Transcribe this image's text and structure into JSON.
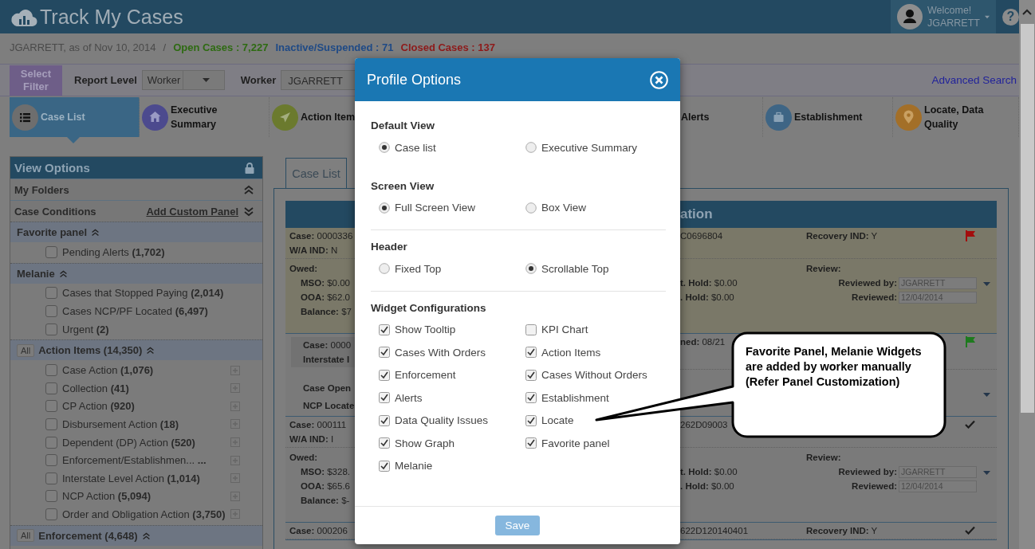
{
  "header": {
    "title": "Track My Cases",
    "welcome": "Welcome!",
    "user": "JGARRETT",
    "help": "?"
  },
  "info_bar": {
    "as_of": "JGARRETT, as of Nov 10, 2014",
    "separator": "/",
    "stats": [
      {
        "text": "Open Cases : 7,227",
        "color": "#2e6b12"
      },
      {
        "text": "Inactive/Suspended : 71",
        "color": "#1f4a86"
      },
      {
        "text": "Closed Cases : 137",
        "color": "#8e1a1a"
      }
    ]
  },
  "filter_bar": {
    "select_filter": "Select Filter",
    "report_level_label": "Report Level",
    "report_level": "Worker",
    "worker_label": "Worker",
    "worker": "JGARRETT",
    "advanced_search": "Advanced Search"
  },
  "nav": [
    {
      "label": "Case List",
      "selected": true,
      "color": "#6e6e6e"
    },
    {
      "label": "Executive Summary",
      "selected": false,
      "color": "#4c4a8e"
    },
    {
      "label": "Action Item",
      "selected": false,
      "color": "#6b7a2e"
    },
    {
      "label": "Alerts",
      "selected": false
    },
    {
      "label": "Establishment",
      "selected": false,
      "color": "#3e6585"
    },
    {
      "label": "Locate, Data Quality",
      "selected": false,
      "color": "#a36f28"
    }
  ],
  "sidebar": {
    "title": "View Options",
    "folders": [
      {
        "label": "My Folders",
        "expanded": true
      },
      {
        "label": "Case Conditions",
        "link": "Add Custom Panel",
        "expanded": false
      }
    ],
    "groups": [
      {
        "title": "Favorite panel",
        "expanded": true,
        "items": [
          {
            "text": "Pending Alerts **(1,702)**",
            "checked": false
          }
        ]
      },
      {
        "title": "Melanie",
        "expanded": true,
        "items": [
          {
            "text": "Cases that Stopped Paying **(2,014)**",
            "checked": false
          },
          {
            "text": "Cases NCP/PF Located **(6,497)**",
            "checked": false
          },
          {
            "text": "Urgent **(2)**",
            "checked": false
          }
        ]
      },
      {
        "all": "All",
        "title": "Action Items (14,350)",
        "expanded": true,
        "items": [
          {
            "text": "Case Action **(1,076)**",
            "checked": false,
            "expandable": true
          },
          {
            "text": "Collection **(41)**",
            "checked": false,
            "expandable": true
          },
          {
            "text": "CP Action **(920)**",
            "checked": false,
            "expandable": true
          },
          {
            "text": "Disbursement Action **(18)**",
            "checked": false,
            "expandable": true
          },
          {
            "text": "Dependent (DP) Action **(520)**",
            "checked": false,
            "expandable": true
          },
          {
            "text": "Enforcement/Establishmen... **...**",
            "checked": false,
            "expandable": true
          },
          {
            "text": "Interstate Level Action **(1,014)**",
            "checked": false,
            "expandable": true
          },
          {
            "text": "NCP Action **(5,094)**",
            "checked": false,
            "expandable": true
          },
          {
            "text": "Order and Obligation Action **(3,750)**",
            "checked": false,
            "expandable": true
          }
        ]
      },
      {
        "all": "All",
        "title": "Enforcement (4,648)",
        "expanded": true
      }
    ]
  },
  "case_list": {
    "tab": "Case List",
    "heading": "ation",
    "rows": [
      {
        "highlighted": true,
        "top_left": [
          "**Case:** 0000336",
          "**W/A IND:** N"
        ],
        "top_right": [
          "C0696804",
          "**Recovery IND:** Y"
        ],
        "marker": {
          "kind": "flag",
          "color": "#a30d0d"
        },
        "bottom_left": {
          "title": "Owed:",
          "lines": [
            "**MSO:** $0.00",
            "**OOA:** $62.0",
            "**Balance:** $7"
          ]
        },
        "holds": [
          "**t. Hold:** $0.00",
          "**. Hold:** $0.00"
        ],
        "review": {
          "title": "Review:",
          "fields": [
            {
              "label": "Reviewed by:",
              "value": "JGARRETT"
            },
            {
              "label": "Reviewed:",
              "value": "12/04/2014"
            }
          ]
        },
        "has_menu": true
      },
      {
        "highlighted": false,
        "inset": true,
        "top_left": [
          "**Case:** 0000",
          "**Interstate I**"
        ],
        "top_right": [
          "**ned:** 08/21"
        ],
        "marker": {
          "kind": "flag",
          "color": "#1e7a1e"
        },
        "bottom_left": {
          "lines": [
            "**Case Open**",
            "**NCP Locate**"
          ]
        },
        "has_menu": true
      },
      {
        "highlighted": false,
        "top_left": [
          "**Case:** 000111",
          "**W/A IND:** I"
        ],
        "top_right": [
          "262D09003"
        ],
        "marker": {
          "kind": "check"
        },
        "bottom_left": {
          "title": "Owed:",
          "lines": [
            "**MSO:** $328.",
            "**OOA:** $65.6",
            "**Balance:** $-"
          ]
        },
        "holds": [
          "**t. Hold:** $0.00",
          "**. Hold:** $0.00"
        ],
        "review": {
          "title": "Review:",
          "fields": [
            {
              "label": "Reviewed by:",
              "value": "JGARRETT"
            },
            {
              "label": "Reviewed:",
              "value": "12/04/2014"
            }
          ]
        },
        "has_menu": true
      },
      {
        "highlighted": false,
        "top_left": [
          "**Case:** 000206"
        ],
        "top_right": [
          "622D120140401",
          "**Recovery IND:** Y"
        ],
        "marker": {
          "kind": "check"
        }
      }
    ]
  },
  "modal": {
    "title": "Profile Options",
    "sections": [
      {
        "title": "Default View",
        "kind": "radio",
        "options": [
          {
            "label": "Case list",
            "selected": true
          },
          {
            "label": "Executive Summary",
            "selected": false
          }
        ]
      },
      {
        "title": "Screen View",
        "kind": "radio",
        "options": [
          {
            "label": "Full Screen View",
            "selected": true
          },
          {
            "label": "Box View",
            "selected": false
          }
        ]
      },
      {
        "title": "Header",
        "kind": "radio",
        "separated": true,
        "options": [
          {
            "label": "Fixed Top",
            "selected": false
          },
          {
            "label": "Scrollable Top",
            "selected": true
          }
        ]
      },
      {
        "title": "Widget Configurations",
        "kind": "checkbox",
        "separated": true,
        "options": [
          {
            "label": "Show Tooltip",
            "checked": true
          },
          {
            "label": "KPI Chart",
            "checked": false
          },
          {
            "label": "Cases With Orders",
            "checked": true
          },
          {
            "label": "Action Items",
            "checked": true
          },
          {
            "label": "Enforcement",
            "checked": true
          },
          {
            "label": "Cases Without Orders",
            "checked": true
          },
          {
            "label": "Alerts",
            "checked": true
          },
          {
            "label": "Establishment",
            "checked": true
          },
          {
            "label": "Data Quality Issues",
            "checked": true
          },
          {
            "label": "Locate",
            "checked": true
          },
          {
            "label": "Show Graph",
            "checked": true
          },
          {
            "label": "Favorite panel",
            "checked": true
          },
          {
            "label": "Melanie",
            "checked": true
          }
        ]
      }
    ],
    "save": "Save"
  },
  "callout": {
    "text": "Favorite Panel, Melanie Widgets are added by worker manually (Refer Panel Customization)"
  }
}
